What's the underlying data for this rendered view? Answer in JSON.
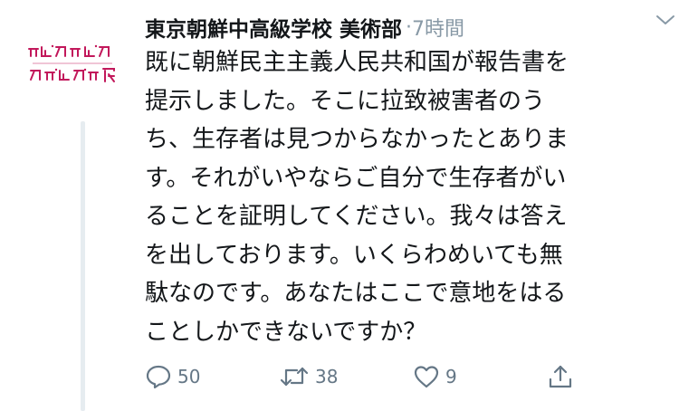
{
  "tweet": {
    "author_name": "東京朝鮮中高級学校 美術部",
    "separator": "·",
    "timestamp": "7時間",
    "avatar_alt": "プロジェクト展",
    "text_lines": [
      "既に朝鮮民主主義人民共和国が報告書を",
      "提示しました。そこに拉致被害者のう",
      "ち、生存者は見つからなかったとありま",
      "す。それがいやならご自分で生存者がい",
      "ることを証明してください。我々は答え",
      "を出しております。いくらわめいても無",
      "駄なのです。あなたはここで意地をはる",
      "ことしかできないですか？"
    ]
  },
  "actions": {
    "reply_icon": "reply-icon",
    "reply_count": "50",
    "retweet_icon": "retweet-icon",
    "retweet_count": "38",
    "like_icon": "heart-icon",
    "like_count": "9",
    "share_icon": "share-icon"
  },
  "colors": {
    "text": "#14171a",
    "muted": "#8899a6",
    "icon": "#657786",
    "thread_line": "#e6ecf0",
    "avatar_accent": "#c2185b"
  }
}
